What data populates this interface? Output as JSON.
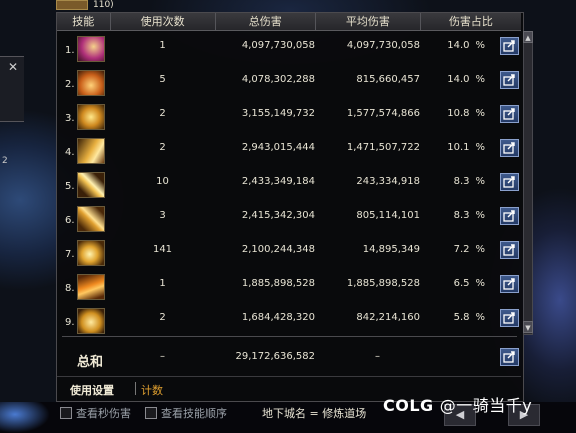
{
  "header": {
    "level_text": "110)",
    "columns": [
      "技能",
      "使用次数",
      "总伤害",
      "平均伤害",
      "伤害占比"
    ]
  },
  "rows": [
    {
      "idx": "1.",
      "uses": "1",
      "total": "4,097,730,058",
      "avg": "4,097,730,058",
      "pct": "14.0",
      "pct_sym": "%"
    },
    {
      "idx": "2.",
      "uses": "5",
      "total": "4,078,302,288",
      "avg": "815,660,457",
      "pct": "14.0",
      "pct_sym": "%"
    },
    {
      "idx": "3.",
      "uses": "2",
      "total": "3,155,149,732",
      "avg": "1,577,574,866",
      "pct": "10.8",
      "pct_sym": "%"
    },
    {
      "idx": "4.",
      "uses": "2",
      "total": "2,943,015,444",
      "avg": "1,471,507,722",
      "pct": "10.1",
      "pct_sym": "%"
    },
    {
      "idx": "5.",
      "uses": "10",
      "total": "2,433,349,184",
      "avg": "243,334,918",
      "pct": "8.3",
      "pct_sym": "%"
    },
    {
      "idx": "6.",
      "uses": "3",
      "total": "2,415,342,304",
      "avg": "805,114,101",
      "pct": "8.3",
      "pct_sym": "%"
    },
    {
      "idx": "7.",
      "uses": "141",
      "total": "2,100,244,348",
      "avg": "14,895,349",
      "pct": "7.2",
      "pct_sym": "%"
    },
    {
      "idx": "8.",
      "uses": "1",
      "total": "1,885,898,528",
      "avg": "1,885,898,528",
      "pct": "6.5",
      "pct_sym": "%"
    },
    {
      "idx": "9.",
      "uses": "2",
      "total": "1,684,428,320",
      "avg": "842,214,160",
      "pct": "5.8",
      "pct_sym": "%"
    }
  ],
  "summary": {
    "label": "总和",
    "uses": "–",
    "total": "29,172,636,582",
    "avg": "–"
  },
  "tabs": {
    "settings": "使用设置",
    "count": "计数"
  },
  "options": {
    "show_dps": "查看秒伤害",
    "show_order": "查看技能顺序",
    "dungeon": "地下城名 = 修炼道场"
  },
  "nav": {
    "prev": "◀",
    "next": "▶"
  },
  "watermark": {
    "logo": "COLG",
    "name": "@一骑当千y"
  },
  "left_panel": {
    "close": "✕",
    "num": "2"
  },
  "colors": {
    "accent_tab": "#e0a030",
    "share_button": "#3f5a8c"
  }
}
